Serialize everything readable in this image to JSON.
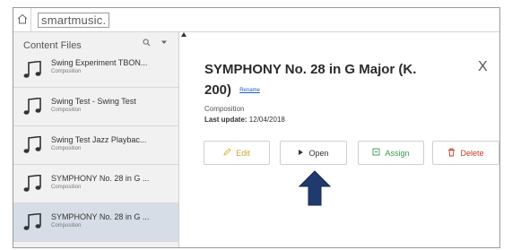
{
  "app": {
    "brand": "smartmusic."
  },
  "icons": {
    "home": "home-icon",
    "search": "search-icon",
    "dropdown": "chevron-down-icon",
    "note": "music-note-icon",
    "edit": "pencil-icon",
    "open": "play-icon",
    "assign": "assign-icon",
    "delete": "trash-icon",
    "close": "close-icon",
    "arrow": "arrow-up-icon"
  },
  "sidebar": {
    "title": "Content Files",
    "items": [
      {
        "title": "Swing Experiment TBON...",
        "subtitle": "Composition"
      },
      {
        "title": "Swing Test - Swing Test",
        "subtitle": "Composition"
      },
      {
        "title": "Swing Test Jazz Playbac...",
        "subtitle": "Composition"
      },
      {
        "title": "SYMPHONY No. 28 in G ...",
        "subtitle": "Composition"
      },
      {
        "title": "SYMPHONY No. 28 in G ...",
        "subtitle": "Composition"
      }
    ],
    "selected_index": 4
  },
  "detail": {
    "title": "SYMPHONY No. 28 in G Major (K. 200)",
    "rename_label": "Rename",
    "close_label": "X",
    "type": "Composition",
    "last_update_label": "Last update:",
    "last_update_value": "12/04/2018",
    "buttons": {
      "edit": "Edit",
      "open": "Open",
      "assign": "Assign",
      "delete": "Delete"
    }
  },
  "colors": {
    "selected_row": "#d7dde6",
    "sidebar_bg": "#f1f1f1",
    "arrow": "#1f3b6e",
    "edit": "#c9a52e",
    "assign": "#3a9a4a",
    "delete": "#c0392b"
  }
}
